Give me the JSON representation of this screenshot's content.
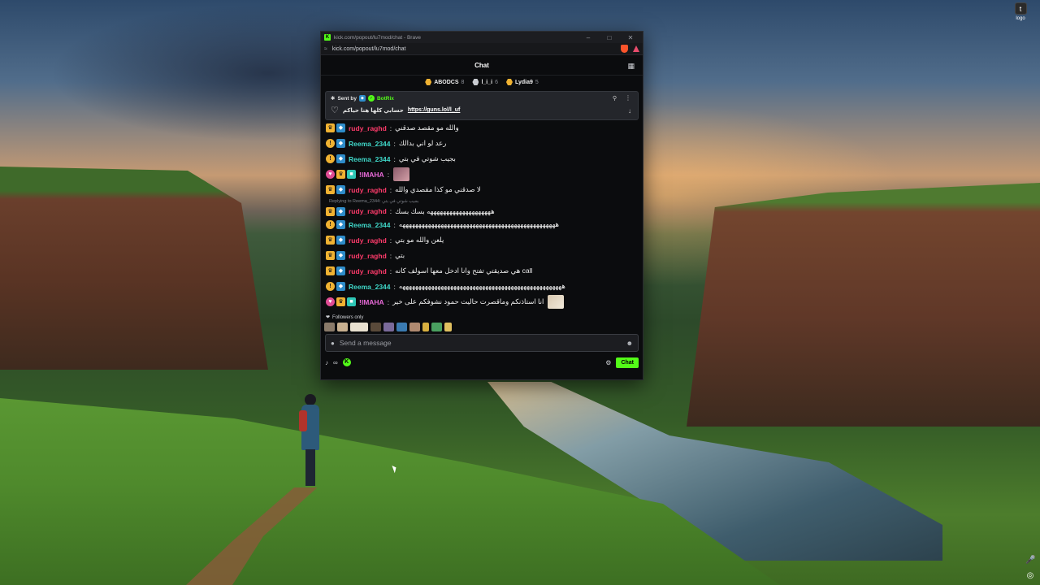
{
  "desktop": {
    "icon_label": "logo",
    "icon_glyph": "t"
  },
  "window": {
    "title": "kick.com/popout/lu7mod/chat - Brave",
    "url": "kick.com/popout/lu7mod/chat"
  },
  "chat": {
    "header_title": "Chat",
    "leaderboard": [
      {
        "name": "ABODCS",
        "count": "8"
      },
      {
        "name": "l_i_i",
        "count": "6"
      },
      {
        "name": "Lydia9",
        "count": "5"
      }
    ],
    "pinned": {
      "sent_by_label": "Sent by",
      "bot_name": "BotRix",
      "text": "حسابي كلها هنا حياكم",
      "link": "https://guns.lol/l_uf"
    },
    "messages": [
      {
        "user": "rudy_raghd",
        "text": "والله مو مقصد صدقني"
      },
      {
        "user": "Reema_2344",
        "text": "رعد لو اني بدالك"
      },
      {
        "user": "Reema_2344",
        "text": "بجيب شوتي في بتي"
      },
      {
        "user": "!IMAHA",
        "text": ""
      },
      {
        "user": "rudy_raghd",
        "text": "لا صدقني مو كذا مقصدي والله"
      },
      {
        "user": "rudy_raghd",
        "text": "ههههههههههههههههههههه بسك بسك"
      },
      {
        "user": "Reema_2344",
        "text": "هههههههههههههههههههههههههههههههههههههههههههههههههه"
      },
      {
        "user": "rudy_raghd",
        "text": "يلعن والله مو بتي"
      },
      {
        "user": "rudy_raghd",
        "text": "بتي"
      },
      {
        "user": "rudy_raghd",
        "text": "هي صديقتي تفتح وانا ادخل معها اسولف كانه call"
      },
      {
        "user": "Reema_2344",
        "text": "هههههههههههههههههههههههههههههههههههههههههههههههههههه"
      },
      {
        "user": "!IMAHA",
        "text": "انا استاذنكم وماقصرت حاليت حمود نشوفكم على خير"
      }
    ],
    "reply_label": "Replying to Reema_2344: بجيب شوتي في بتي",
    "followers_label": "Followers only",
    "input_placeholder": "Send a message",
    "chat_button": "Chat"
  },
  "colors": {
    "kick_green": "#53fc18",
    "rudy": "#ff3b6b",
    "reema": "#3fd8c9",
    "limaha": "#e86ad8"
  }
}
